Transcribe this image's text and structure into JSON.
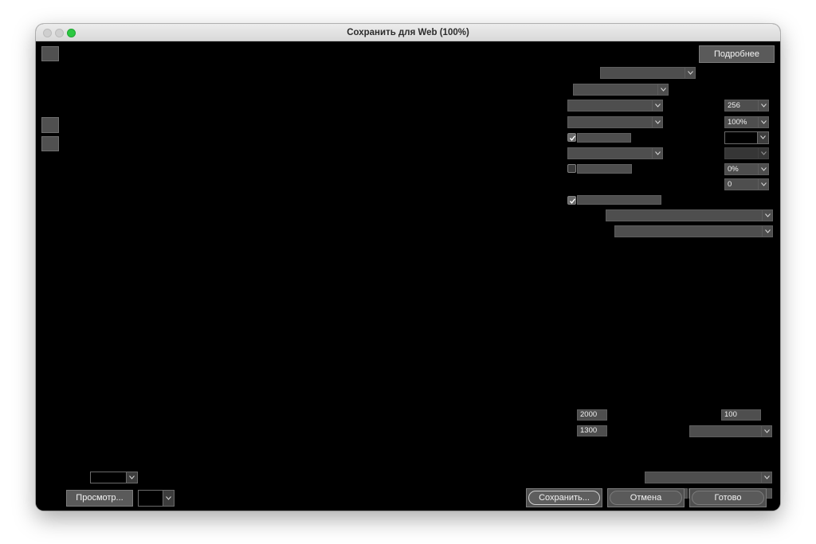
{
  "window": {
    "title": "Сохранить для Web (100%)",
    "traffic_lights": [
      "close",
      "minimize",
      "maximize"
    ],
    "maximize_color": "#2cc842"
  },
  "toolbar_left": {
    "tools": [
      "hand-tool-icon",
      "slice-tool-icon",
      "zoom-tool-icon"
    ]
  },
  "settings": {
    "more_button_label": "Подробнее",
    "colors_value": "256",
    "dither_value": "100%",
    "matte_color": "#000000",
    "lossy_value": "0%",
    "web_snap_value": "0",
    "transparency_checked": true,
    "interlaced_checked": false,
    "embed_profile_checked": true
  },
  "image_size": {
    "width": "2000",
    "height": "1300",
    "percent": "100"
  },
  "bottom": {
    "preview_button_label": "Просмотр...",
    "save_button_label": "Сохранить...",
    "cancel_button_label": "Отмена",
    "done_button_label": "Готово"
  },
  "colors": {
    "canvas": "#000000",
    "control_bg": "#4e4e4e",
    "control_border": "#5d5d5d"
  }
}
